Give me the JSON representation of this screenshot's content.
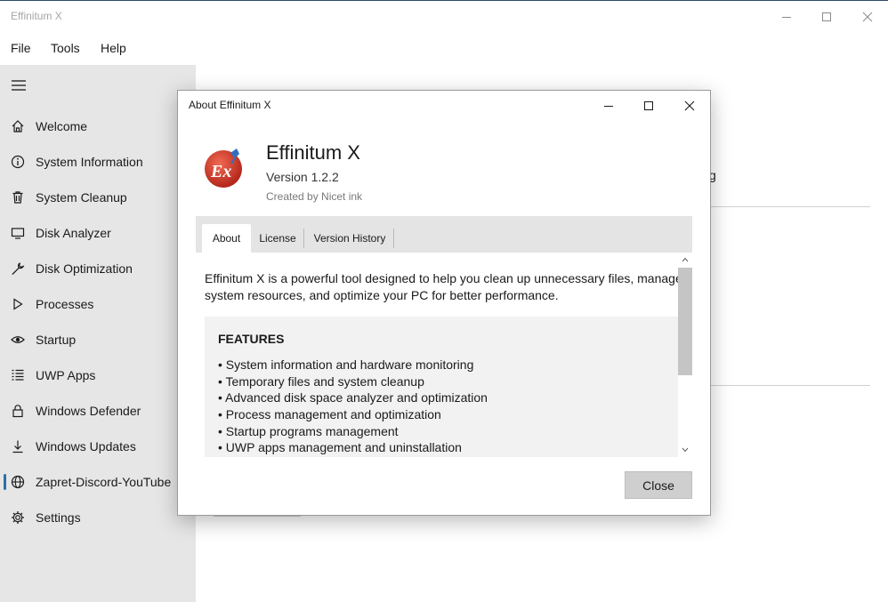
{
  "window": {
    "title": "Effinitum X",
    "controls": [
      "minimize-icon",
      "maximize-icon",
      "close-icon"
    ]
  },
  "menu": [
    "File",
    "Tools",
    "Help"
  ],
  "sidebar": {
    "items": [
      {
        "label": "Welcome",
        "icon": "home-icon"
      },
      {
        "label": "System Information",
        "icon": "info-icon"
      },
      {
        "label": "System Cleanup",
        "icon": "trash-icon"
      },
      {
        "label": "Disk Analyzer",
        "icon": "monitor-icon"
      },
      {
        "label": "Disk Optimization",
        "icon": "wrench-icon"
      },
      {
        "label": "Processes",
        "icon": "play-icon"
      },
      {
        "label": "Startup",
        "icon": "eye-icon"
      },
      {
        "label": "UWP Apps",
        "icon": "list-icon"
      },
      {
        "label": "Windows Defender",
        "icon": "lock-icon"
      },
      {
        "label": "Windows Updates",
        "icon": "download-icon"
      },
      {
        "label": "Zapret-Discord-YouTube",
        "icon": "globe-icon"
      },
      {
        "label": "Settings",
        "icon": "gear-icon"
      }
    ],
    "selected": "Zapret-Discord-YouTube"
  },
  "background": {
    "partial_text": "g"
  },
  "dialog": {
    "title": "About Effinitum X",
    "app_name": "Effinitum X",
    "version": "Version 1.2.2",
    "credit": "Created by Nicet ink",
    "logo_text": "Ex",
    "tabs": [
      "About",
      "License",
      "Version History"
    ],
    "active_tab": "About",
    "intro": "Effinitum X is a powerful tool designed to help you clean up unnecessary files, manage system resources, and optimize your PC for better performance.",
    "features_title": "FEATURES",
    "features": [
      "• System information and hardware monitoring",
      "• Temporary files and system cleanup",
      "• Advanced disk space analyzer and optimization",
      "• Process management and optimization",
      "• Startup programs management",
      "• UWP apps management and uninstallation"
    ],
    "close_label": "Close"
  },
  "colors": {
    "sidebar_bg": "#e6e6e6",
    "accent": "#2f6ea8",
    "logo_red": "#d03a2a",
    "logo_blue": "#2f6fc2"
  }
}
